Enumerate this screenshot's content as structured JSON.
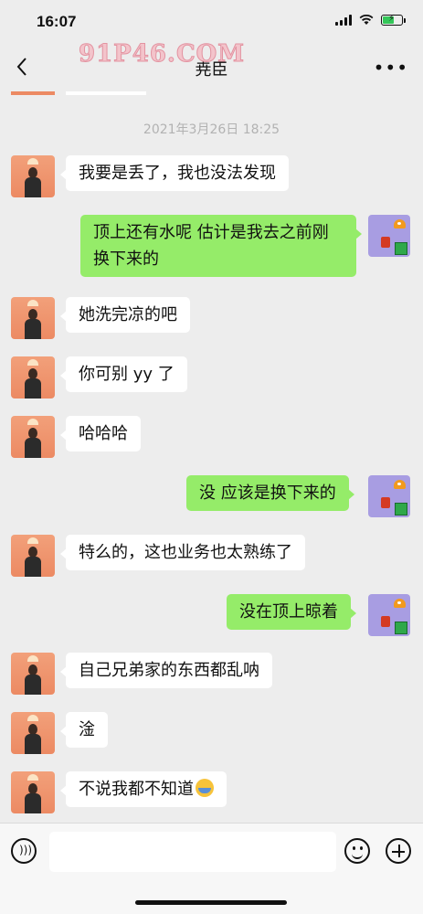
{
  "status": {
    "time": "16:07"
  },
  "header": {
    "title": "尭臣"
  },
  "watermark": {
    "text": "91P46.COM"
  },
  "timestamp": "2021年3月26日 18:25",
  "messages": [
    {
      "side": "in",
      "text": "我要是丢了，我也没法发现"
    },
    {
      "side": "out",
      "text": "顶上还有水呢 估计是我去之前刚换下来的"
    },
    {
      "side": "in",
      "text": "她洗完凉的吧"
    },
    {
      "side": "in",
      "text": "你可别 yy 了"
    },
    {
      "side": "in",
      "text": "哈哈哈"
    },
    {
      "side": "out",
      "text": "没 应该是换下来的"
    },
    {
      "side": "in",
      "text": "特么的，这也业务也太熟练了"
    },
    {
      "side": "out",
      "text": "没在顶上晾着"
    },
    {
      "side": "in",
      "text": "自己兄弟家的东西都乱呐"
    },
    {
      "side": "in",
      "text": "淦"
    },
    {
      "side": "in",
      "text": "不说我都不知道"
    }
  ],
  "icons": {
    "back": "chevron-left-icon",
    "more": "more-icon",
    "voice": "voice-icon",
    "emoji": "emoji-icon",
    "plus": "plus-icon"
  },
  "colors": {
    "background": "#ededed",
    "outgoing_bubble": "#95ec69",
    "incoming_bubble": "#ffffff"
  }
}
